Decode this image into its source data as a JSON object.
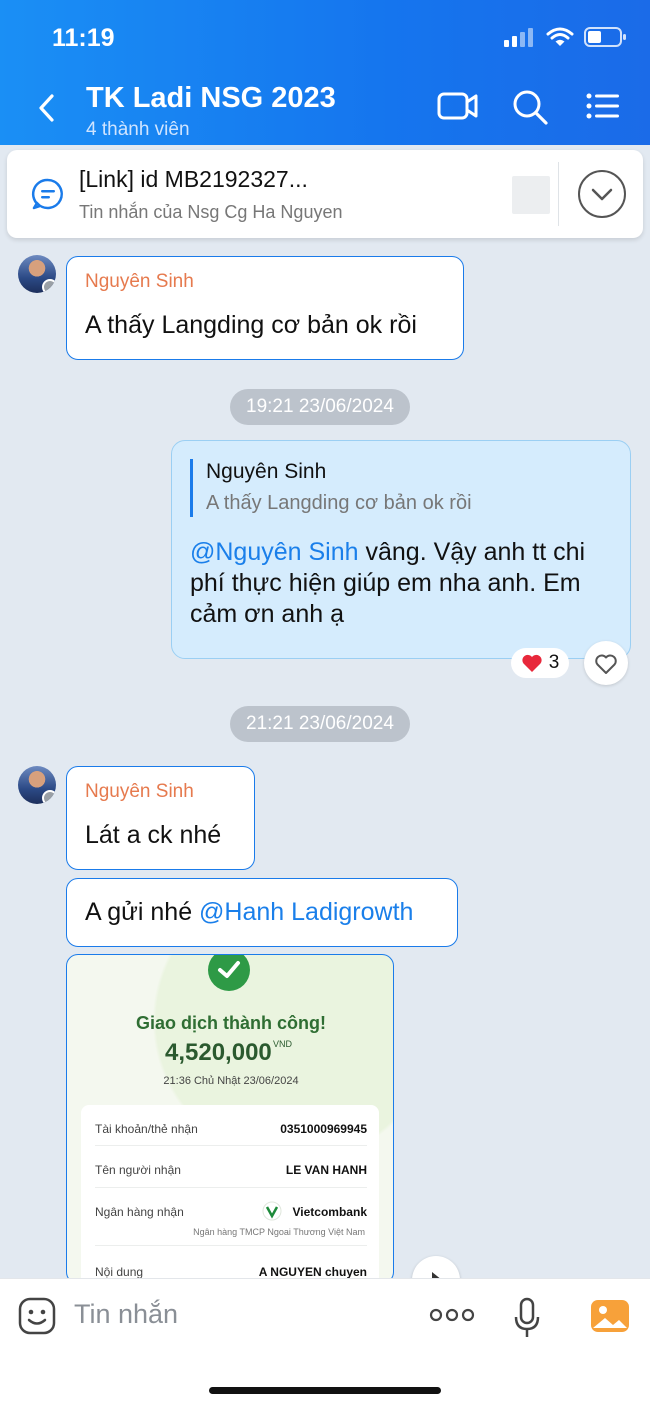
{
  "status": {
    "time": "11:19"
  },
  "header": {
    "title": "TK Ladi NSG 2023",
    "subtitle": "4 thành viên"
  },
  "pinned": {
    "title": "[Link] id MB2192327...",
    "subtitle": "Tin nhắn của Nsg Cg Ha Nguyen"
  },
  "messages": {
    "m1": {
      "sender": "Nguyên Sinh",
      "text": "A thấy Langding cơ bản ok rồi"
    },
    "time1": "19:21 23/06/2024",
    "reply": {
      "quote_name": "Nguyên Sinh",
      "quote_text": "A thấy Langding cơ bản ok rồi",
      "mention": "@Nguyên Sinh",
      "text": " vâng. Vậy anh tt chi phí thực hiện giúp em nha anh. Em cảm ơn anh ạ",
      "reaction_count": "3"
    },
    "time2": "21:21 23/06/2024",
    "m2": {
      "sender": "Nguyên Sinh",
      "text": "Lát a ck nhé"
    },
    "m3": {
      "text": "A gửi nhé ",
      "mention": "@Hanh Ladigrowth"
    }
  },
  "receipt": {
    "status": "Giao dịch thành công!",
    "amount": "4,520,000",
    "currency": "VND",
    "datetime": "21:36 Chủ Nhật 23/06/2024",
    "rows": [
      {
        "label": "Tài khoản/thẻ nhận",
        "value": "0351000969945"
      },
      {
        "label": "Tên người nhận",
        "value": "LE VAN HANH"
      },
      {
        "label": "Ngân hàng nhận",
        "value": "Vietcombank"
      },
      {
        "label": "Nội dung",
        "value": "A NGUYEN chuyen"
      }
    ],
    "bank_full": "Ngân hàng TMCP Ngoai Thương Việt Nam"
  },
  "input": {
    "placeholder": "Tin nhắn"
  },
  "colors": {
    "header": "#1a8ff5",
    "bubble_border": "#1a7bea",
    "sender": "#e67a4e",
    "mention": "#1a7fea",
    "reply_bg": "#d5ecfd"
  }
}
